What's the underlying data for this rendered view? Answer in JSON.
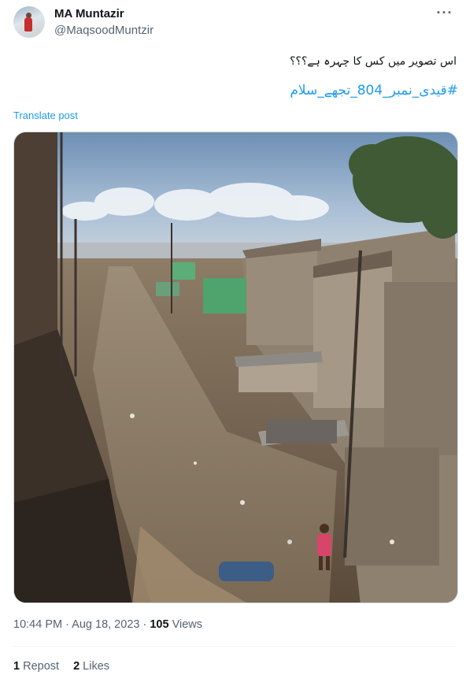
{
  "author": {
    "name": "MA Muntazir",
    "handle": "@MaqsoodMuntzir"
  },
  "more_icon": "more-dots-icon",
  "post": {
    "text": "اس تصویر میں کس کا چہرہ ہے؟؟؟",
    "hashtag": "#قیدی_نمبر_804_تجھے_سلام",
    "translate_label": "Translate post"
  },
  "image": {
    "description_icon": "photo"
  },
  "footer": {
    "time": "10:44 PM",
    "separator": " · ",
    "date": "Aug 18, 2023",
    "views_separator": " · ",
    "views_count": "105",
    "views_label": " Views"
  },
  "engagement": {
    "reposts_count": "1",
    "reposts_label": " Repost",
    "likes_count": "2",
    "likes_label": " Likes"
  },
  "colors": {
    "accent": "#1d9bf0",
    "secondary_text": "#536471",
    "primary_text": "#0f1419"
  }
}
